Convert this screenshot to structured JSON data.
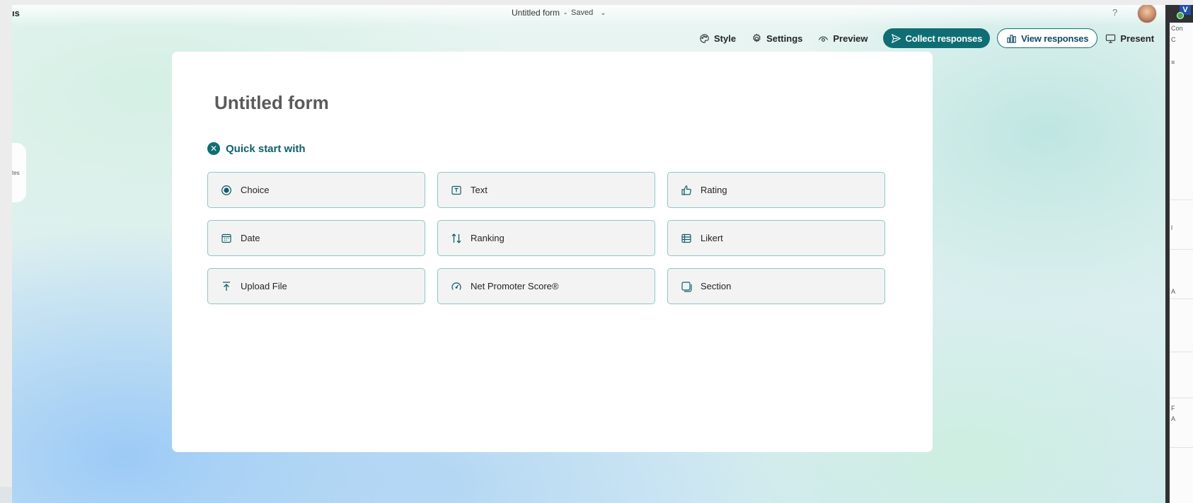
{
  "app": {
    "name_fragment": "ıs",
    "document_title": "Untitled form",
    "separator": "-",
    "save_status": "Saved",
    "help_label": "?"
  },
  "toolbar": {
    "style_label": "Style",
    "settings_label": "Settings",
    "preview_label": "Preview",
    "collect_label": "Collect responses",
    "view_label": "View responses",
    "present_label": "Present",
    "more_label": "···"
  },
  "side_tab": {
    "label": "tes"
  },
  "form": {
    "title": "Untitled form",
    "quick_start_label": "Quick start with",
    "question_types": [
      {
        "label": "Choice",
        "icon": "radio-icon"
      },
      {
        "label": "Text",
        "icon": "text-box-icon"
      },
      {
        "label": "Rating",
        "icon": "thumb-up-icon"
      },
      {
        "label": "Date",
        "icon": "calendar-icon"
      },
      {
        "label": "Ranking",
        "icon": "arrow-sort-icon"
      },
      {
        "label": "Likert",
        "icon": "table-icon"
      },
      {
        "label": "Upload File",
        "icon": "upload-icon"
      },
      {
        "label": "Net Promoter Score®",
        "icon": "gauge-icon"
      },
      {
        "label": "Section",
        "icon": "section-icon"
      }
    ]
  },
  "right_panel": {
    "badge": "V",
    "texts": [
      "Con",
      "C",
      "≡",
      "l",
      "A",
      "F",
      "A"
    ]
  },
  "colors": {
    "accent": "#0f6e73",
    "card_border": "#8fc6c6",
    "card_bg": "#f3f3f3"
  }
}
